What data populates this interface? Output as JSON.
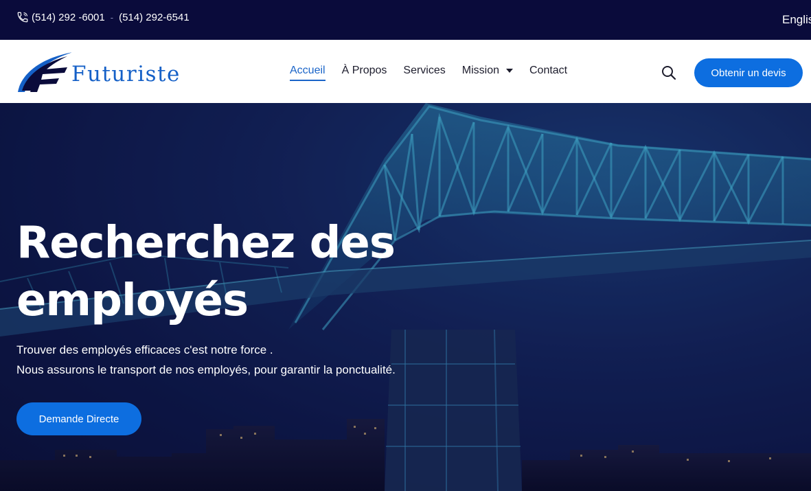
{
  "topbar": {
    "phone_1": "(514) 292 -6001",
    "separator": "-",
    "phone_2": "(514) 292-6541",
    "language": "English"
  },
  "header": {
    "logo_text": "Futuriste",
    "nav": [
      {
        "label": "Accueil",
        "active": true
      },
      {
        "label": "À Propos"
      },
      {
        "label": "Services"
      },
      {
        "label": "Mission",
        "has_dropdown": true
      },
      {
        "label": "Contact"
      }
    ],
    "quote_button": "Obtenir un devis"
  },
  "hero": {
    "title_line_1": "Recherchez des",
    "title_line_2": "employés",
    "subtitle_line_1": "Trouver des employés efficaces c'est notre force .",
    "subtitle_line_2": "Nous assurons le transport de nos employés, pour garantir la ponctualité.",
    "cta_button": "Demande Directe"
  },
  "colors": {
    "topbar_bg": "#0a0b3b",
    "accent": "#0d6ee0",
    "nav_active": "#1a64c8",
    "logo_blue": "#1560c7"
  },
  "icons": [
    "phone-icon",
    "search-icon",
    "chevron-down-icon"
  ]
}
